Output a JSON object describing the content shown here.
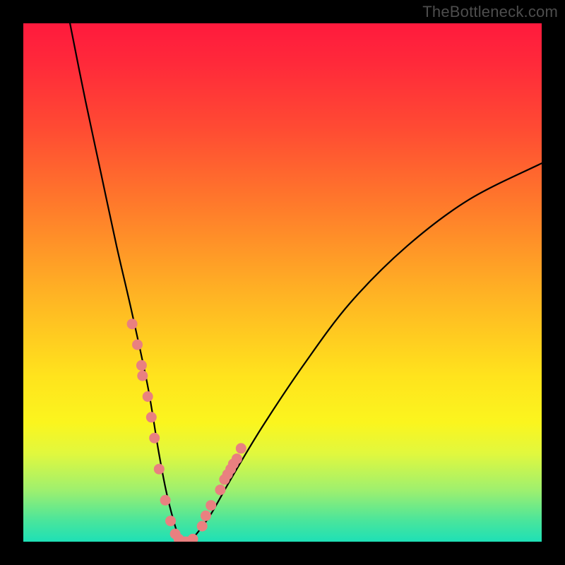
{
  "attribution": "TheBottleneck.com",
  "colors": {
    "frame": "#000000",
    "gradient_top": "#ff1a3d",
    "gradient_mid": "#ffe31d",
    "gradient_bottom": "#1ee0b6",
    "curve": "#000000",
    "marker": "#e98080"
  },
  "chart_data": {
    "type": "line",
    "title": "",
    "xlabel": "",
    "ylabel": "",
    "xlim": [
      0,
      100
    ],
    "ylim": [
      0,
      100
    ],
    "grid": false,
    "legend_position": "none",
    "series": [
      {
        "name": "bottleneck-curve",
        "x": [
          9,
          12,
          15,
          18,
          21,
          24,
          26,
          27.5,
          29,
          30,
          31,
          32,
          33,
          36,
          40,
          46,
          54,
          63,
          74,
          86,
          100
        ],
        "y": [
          100,
          85,
          71,
          57,
          44,
          30,
          18,
          10,
          4,
          1,
          0,
          0,
          1,
          5,
          12,
          22,
          34,
          46,
          57,
          66,
          73
        ]
      }
    ],
    "markers": {
      "name": "highlight-points",
      "left_branch": {
        "x": [
          21.0,
          22.0,
          22.8,
          23.0,
          24.0,
          24.7,
          25.3,
          26.2,
          27.4,
          28.4,
          29.3,
          30.0
        ],
        "y": [
          42,
          38,
          34,
          32,
          28,
          24,
          20,
          14,
          8,
          4,
          1.5,
          0.5
        ]
      },
      "valley": {
        "x": [
          30.6,
          31.3,
          32.0,
          32.7
        ],
        "y": [
          0,
          0,
          0,
          0.5
        ]
      },
      "right_branch": {
        "x": [
          34.5,
          35.2,
          36.2,
          38.0,
          38.8,
          39.4,
          40,
          40.5,
          41.2,
          42.0
        ],
        "y": [
          3,
          5,
          7,
          10,
          12,
          13,
          14,
          15,
          16,
          18
        ]
      }
    },
    "annotations": []
  }
}
